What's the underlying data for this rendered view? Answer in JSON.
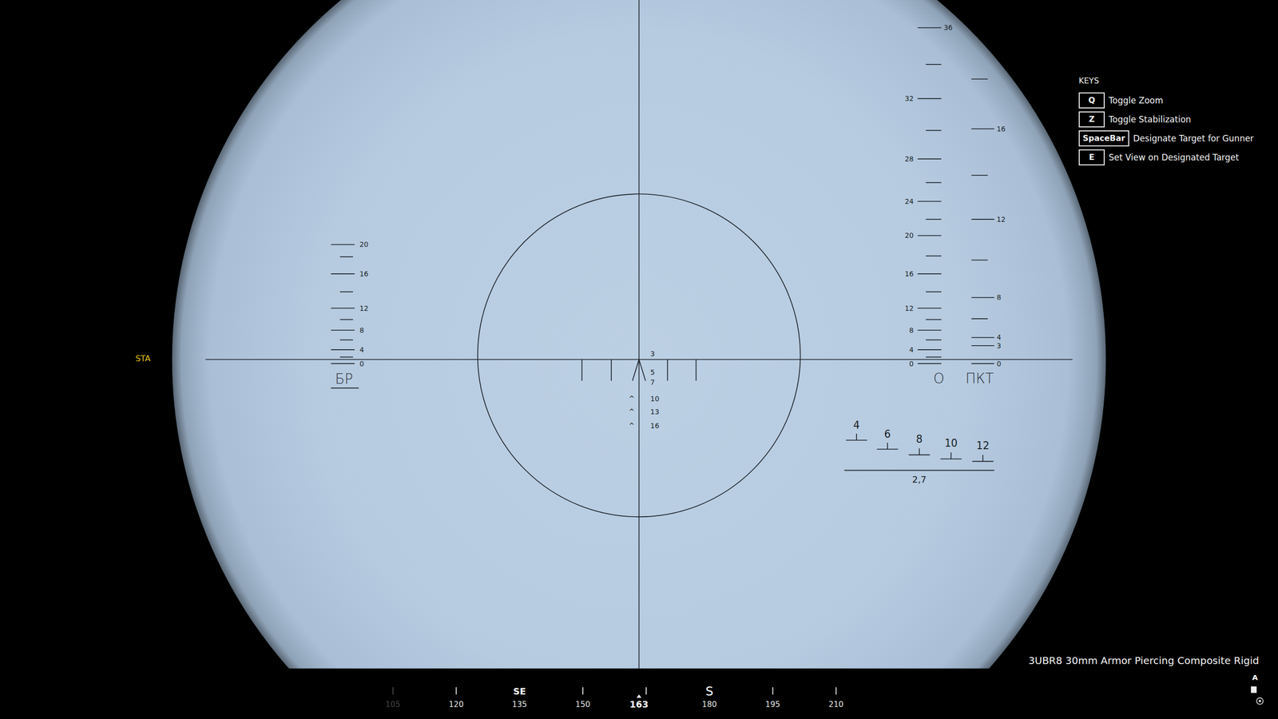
{
  "sight": {
    "stabilization": "STA"
  },
  "scales": [
    {
      "name": "БР",
      "marks": [
        "20",
        "",
        "16",
        "",
        "12",
        "",
        "8",
        "",
        "4",
        "",
        "0"
      ]
    },
    {
      "name": "О",
      "marks": [
        "36",
        "",
        "32",
        "",
        "28",
        "",
        "24",
        "",
        "20",
        "",
        "16",
        "",
        "12",
        "",
        "8",
        "",
        "4",
        "",
        "0"
      ]
    },
    {
      "name": "ПКТ",
      "marks": [
        "",
        "16",
        "",
        "12",
        "",
        "8",
        "",
        "4",
        "3",
        "0"
      ]
    }
  ],
  "range_marks": [
    {
      "label": "3",
      "kind": "plain",
      "mark": ""
    },
    {
      "label": "5",
      "kind": "plain",
      "mark": ""
    },
    {
      "label": "7",
      "kind": "plain",
      "mark": ""
    },
    {
      "label": "10",
      "kind": "chevron",
      "mark": "^"
    },
    {
      "label": "13",
      "kind": "chevron",
      "mark": "^"
    },
    {
      "label": "16",
      "kind": "chevron",
      "mark": "^"
    }
  ],
  "stadia": {
    "marks": [
      "4",
      "6",
      "8",
      "10",
      "12"
    ],
    "base": "2,7"
  },
  "keys": {
    "title": "KEYS",
    "items": [
      {
        "key": "Q",
        "label": "Toggle Zoom"
      },
      {
        "key": "Z",
        "label": "Toggle Stabilization"
      },
      {
        "key": "SpaceBar",
        "label": "Designate Target for Gunner"
      },
      {
        "key": "E",
        "label": "Set View on Designated Target"
      }
    ]
  },
  "ammo": "3UBR8 30mm Armor Piercing Composite Rigid",
  "compass": {
    "heading": "163",
    "ticks": [
      {
        "above": "",
        "below": "105",
        "faded": true
      },
      {
        "above": "",
        "below": "120",
        "faded": false
      },
      {
        "above": "SE",
        "below": "135",
        "faded": false
      },
      {
        "above": "",
        "below": "150",
        "faded": false
      },
      {
        "above": "",
        "below": "",
        "faded": false
      },
      {
        "above": "S",
        "below": "180",
        "faded": false
      },
      {
        "above": "",
        "below": "195",
        "faded": false
      },
      {
        "above": "",
        "below": "210",
        "faded": false
      }
    ]
  },
  "indicator": {
    "label": "A"
  }
}
